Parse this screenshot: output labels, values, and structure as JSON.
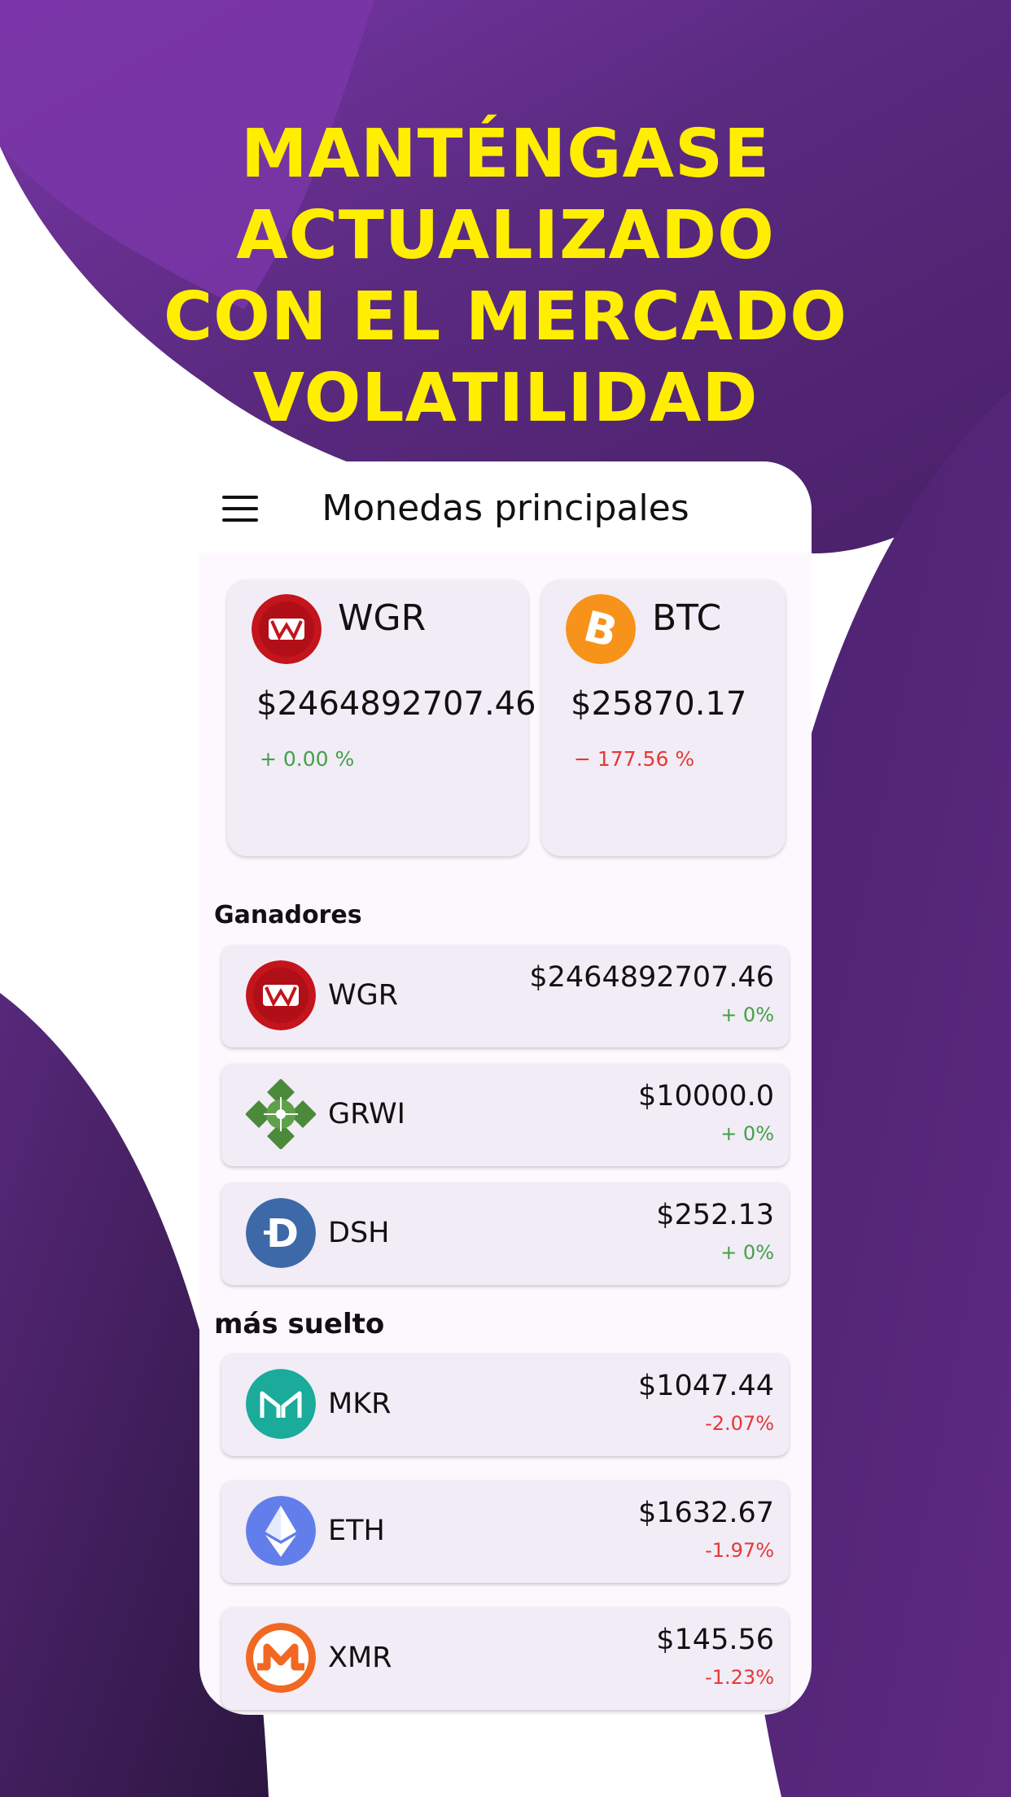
{
  "headline": [
    "MANTÉNGASE",
    "ACTUALIZADO",
    "CON EL MERCADO",
    "VOLATILIDAD"
  ],
  "colors": {
    "headline": "#ffee00",
    "purple_dark": "#4a2068",
    "purple_light": "#7838a8",
    "positive": "#43a047",
    "negative": "#e53935"
  },
  "appbar": {
    "title": "Monedas principales",
    "menu_icon": "hamburger-menu-icon"
  },
  "top_coins": [
    {
      "symbol": "WGR",
      "price": "$2464892707.46",
      "change": "+ 0.00 %",
      "trend": "up",
      "icon": "wgr-logo-icon"
    },
    {
      "symbol": "BTC",
      "price": "$25870.17",
      "change": "− 177.56 %",
      "trend": "down",
      "icon": "bitcoin-logo-icon"
    }
  ],
  "gainers": {
    "title": "Ganadores",
    "items": [
      {
        "symbol": "WGR",
        "price": "$2464892707.46",
        "change": "+ 0%",
        "icon": "wgr-logo-icon"
      },
      {
        "symbol": "GRWI",
        "price": "$10000.0",
        "change": "+ 0%",
        "icon": "grwi-logo-icon"
      },
      {
        "symbol": "DSH",
        "price": "$252.13",
        "change": "+ 0%",
        "icon": "dash-logo-icon"
      }
    ]
  },
  "losers": {
    "title": "más suelto",
    "items": [
      {
        "symbol": "MKR",
        "price": "$1047.44",
        "change": "-2.07%",
        "icon": "maker-logo-icon"
      },
      {
        "symbol": "ETH",
        "price": "$1632.67",
        "change": "-1.97%",
        "icon": "ethereum-logo-icon"
      },
      {
        "symbol": "XMR",
        "price": "$145.56",
        "change": "-1.23%",
        "icon": "monero-logo-icon"
      }
    ]
  }
}
